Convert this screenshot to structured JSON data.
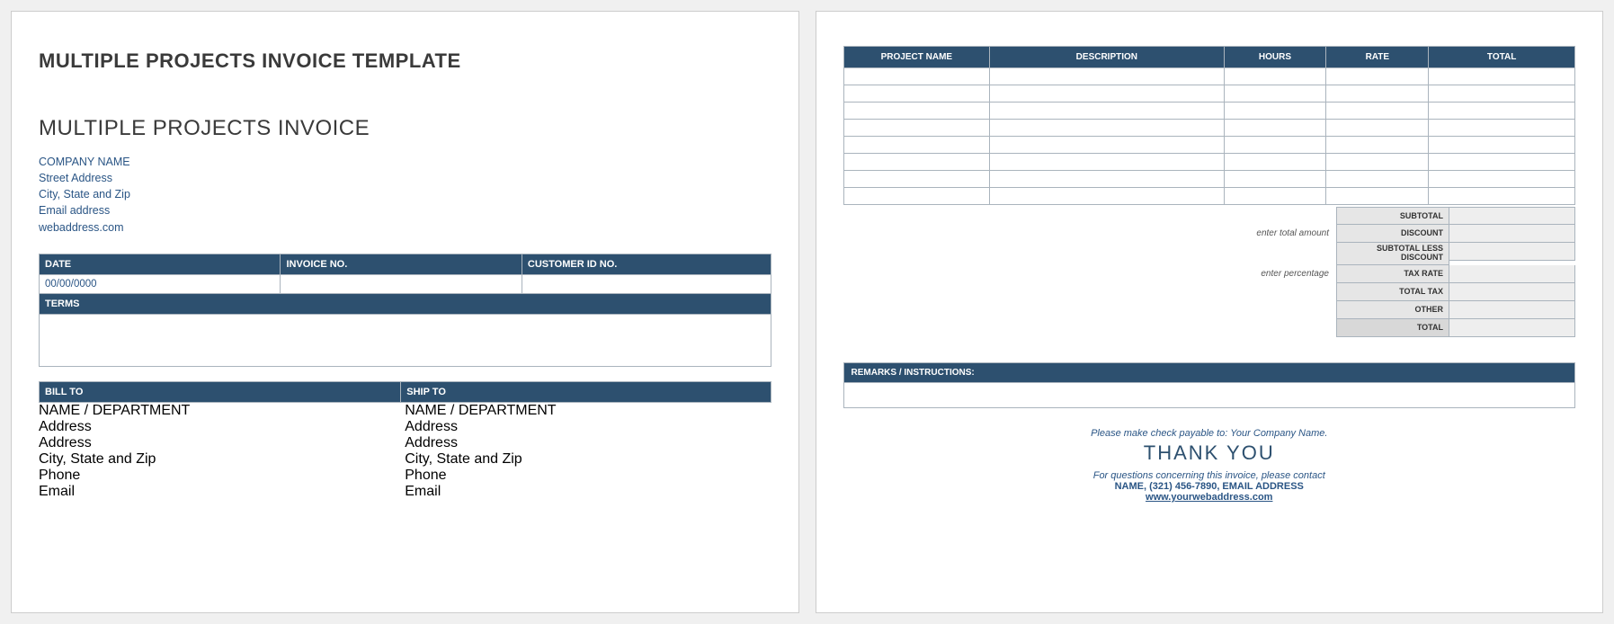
{
  "page1": {
    "template_title": "MULTIPLE PROJECTS INVOICE TEMPLATE",
    "doc_title": "MULTIPLE PROJECTS INVOICE",
    "company": {
      "name": "COMPANY NAME",
      "street": "Street Address",
      "citystatezip": "City, State and Zip",
      "email": "Email address",
      "web": "webaddress.com"
    },
    "meta_headers": {
      "date": "DATE",
      "invoice_no": "INVOICE NO.",
      "customer_id": "CUSTOMER ID NO."
    },
    "meta_values": {
      "date": "00/00/0000",
      "invoice_no": "",
      "customer_id": ""
    },
    "terms_header": "TERMS",
    "billto_header": "BILL TO",
    "shipto_header": "SHIP TO",
    "contact_fields": {
      "name": "NAME / DEPARTMENT",
      "addr1": "Address",
      "addr2": "Address",
      "csz": "City, State and Zip",
      "phone": "Phone",
      "email": "Email"
    }
  },
  "page2": {
    "columns": {
      "project": "PROJECT NAME",
      "description": "DESCRIPTION",
      "hours": "HOURS",
      "rate": "RATE",
      "total": "TOTAL"
    },
    "row_count": 8,
    "hints": {
      "amount": "enter total amount",
      "percent": "enter percentage"
    },
    "totals": {
      "subtotal": "SUBTOTAL",
      "discount": "DISCOUNT",
      "subtotal_less": "SUBTOTAL LESS DISCOUNT",
      "tax_rate": "TAX RATE",
      "total_tax": "TOTAL TAX",
      "other": "OTHER",
      "total": "TOTAL"
    },
    "remarks_header": "REMARKS / INSTRUCTIONS:",
    "footer": {
      "payable": "Please make check payable to: Your Company Name.",
      "thanks": "THANK YOU",
      "questions": "For questions concerning this invoice, please contact",
      "contact": "NAME, (321) 456-7890, EMAIL ADDRESS",
      "web": "www.yourwebaddress.com"
    }
  }
}
